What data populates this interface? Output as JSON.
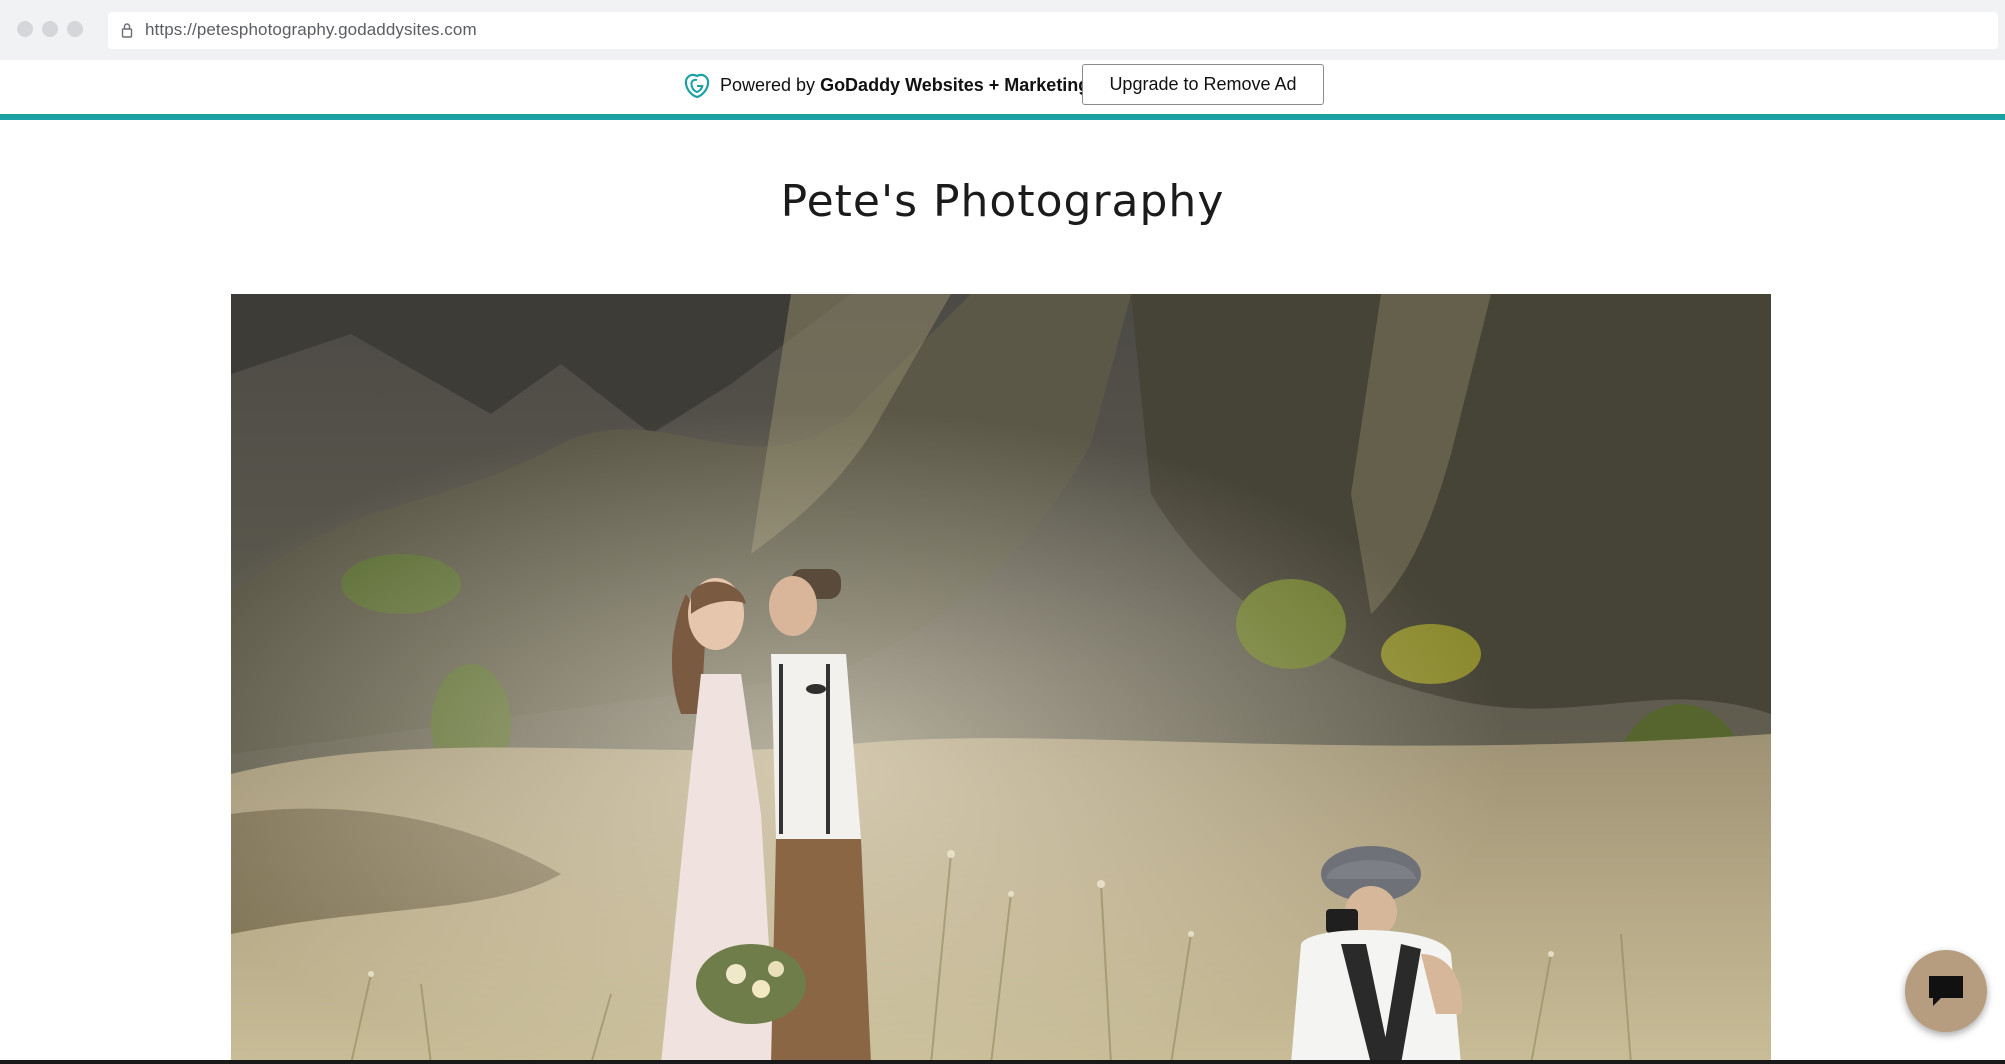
{
  "browser": {
    "url": "https://petesphotography.godaddysites.com"
  },
  "ad_banner": {
    "powered_prefix": "Powered by ",
    "powered_brand": "GoDaddy Websites + Marketing.",
    "upgrade_label": "Upgrade to Remove Ad",
    "accent_color": "#1ba1a2"
  },
  "site": {
    "title": "Pete's Photography"
  },
  "chat": {
    "icon": "chat-bubble-icon",
    "color": "#b79d7f"
  }
}
